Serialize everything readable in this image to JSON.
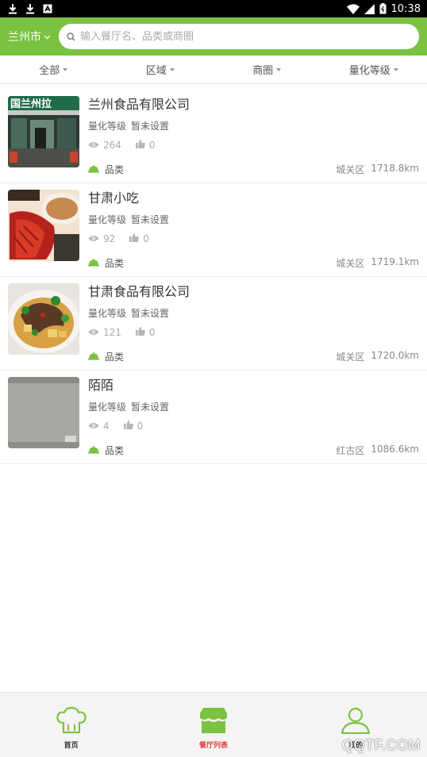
{
  "status_bar": {
    "time": "10:38"
  },
  "header": {
    "city": "兰州市",
    "search_placeholder": "输入餐厅名、品类或商圈"
  },
  "filters": [
    "全部",
    "区域",
    "商圈",
    "量化等级"
  ],
  "restaurants": [
    {
      "name": "兰州食品有限公司",
      "grade_label": "量化等级",
      "grade_value": "暂未设置",
      "views": "264",
      "likes": "0",
      "category": "品类",
      "district": "城关区",
      "distance": "1718.8km"
    },
    {
      "name": "甘肃小吃",
      "grade_label": "量化等级",
      "grade_value": "暂未设置",
      "views": "92",
      "likes": "0",
      "category": "品类",
      "district": "城关区",
      "distance": "1719.1km"
    },
    {
      "name": "甘肃食品有限公司",
      "grade_label": "量化等级",
      "grade_value": "暂未设置",
      "views": "121",
      "likes": "0",
      "category": "品类",
      "district": "城关区",
      "distance": "1720.0km"
    },
    {
      "name": "陌陌",
      "grade_label": "量化等级",
      "grade_value": "暂未设置",
      "views": "4",
      "likes": "0",
      "category": "品类",
      "district": "红古区",
      "distance": "1086.6km"
    }
  ],
  "thumb_sign_text": "国兰州拉",
  "bottom_nav": [
    {
      "label": "首页",
      "active": false
    },
    {
      "label": "餐厅列表",
      "active": true
    },
    {
      "label": "我的",
      "active": false
    }
  ],
  "watermark": "QQTF.COM",
  "colors": {
    "brand_green": "#7cc242",
    "active_nav": "#e04040"
  }
}
